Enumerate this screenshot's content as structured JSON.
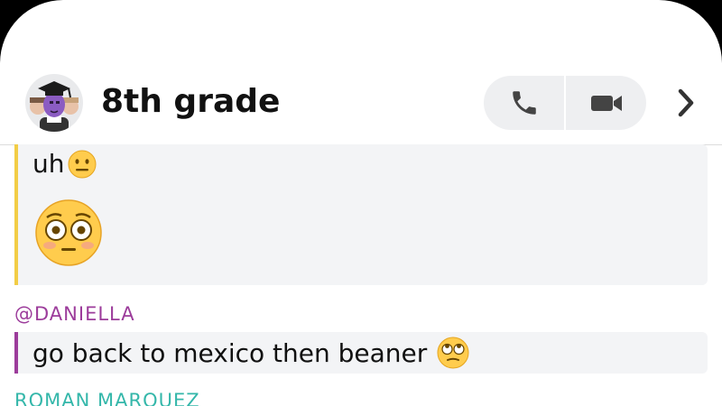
{
  "header": {
    "title": "8th grade",
    "avatar_icon": "group-bitmoji-avatar",
    "call_icon": "phone-icon",
    "video_icon": "video-camera-icon",
    "more_icon": "chevron-right-icon"
  },
  "messages": [
    {
      "accent": "#f2cd46",
      "text": "uh",
      "inline_emoji": "neutral-face-emoji",
      "big_emoji": "flushed-face-emoji"
    },
    {
      "sender": "@DANIELLA",
      "accent": "#9c3c9b",
      "text": "go back to mexico then beaner",
      "inline_emoji": "eye-roll-emoji"
    }
  ],
  "next_sender": "ROMAN MARQUEZ",
  "colors": {
    "accent_yellow": "#f2cd46",
    "accent_purple": "#9c3c9b",
    "accent_teal": "#34b7aa",
    "bubble_bg": "#f3f4f6"
  }
}
